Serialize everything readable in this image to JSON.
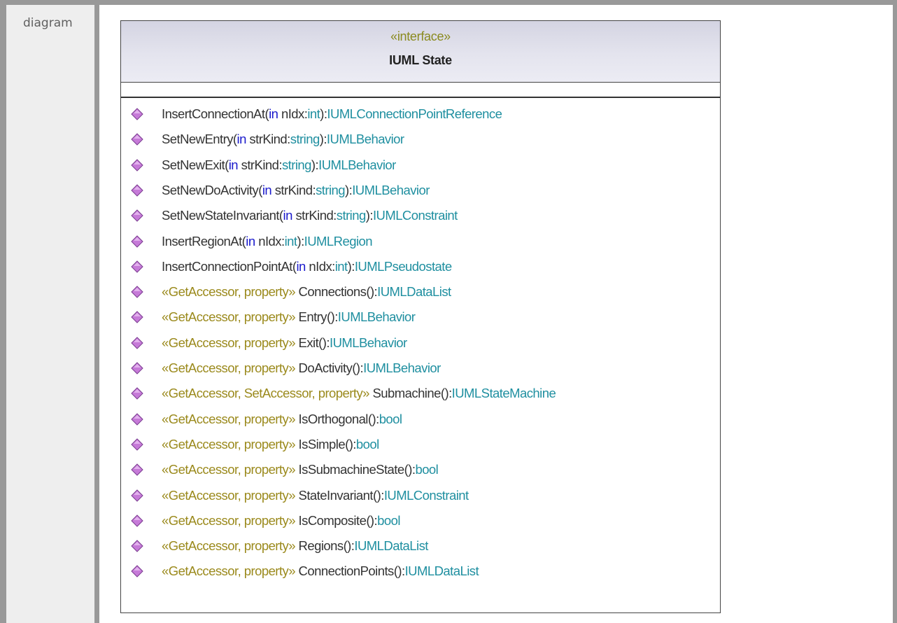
{
  "section_label": "diagram",
  "class_box": {
    "stereotype": "«interface»",
    "name": "IUML State"
  },
  "colors": {
    "header_gradient_top": "#d4d4e2",
    "stereotype": "#9b8a1d",
    "keyword": "#1a1acc",
    "type": "#1f8fa0",
    "icon_fill": "#c67ad8",
    "frame": "#999999"
  },
  "operation_icon": "operation-diamond-icon",
  "operations": [
    {
      "stereotype": "",
      "name": "InsertConnectionAt(",
      "kw": "in",
      "param": " nIdx:",
      "param_type": "int",
      "close": "):",
      "ret": "IUMLConnectionPointReference"
    },
    {
      "stereotype": "",
      "name": "SetNewEntry(",
      "kw": "in",
      "param": " strKind:",
      "param_type": "string",
      "close": "):",
      "ret": "IUMLBehavior"
    },
    {
      "stereotype": "",
      "name": "SetNewExit(",
      "kw": "in",
      "param": " strKind:",
      "param_type": "string",
      "close": "):",
      "ret": "IUMLBehavior"
    },
    {
      "stereotype": "",
      "name": "SetNewDoActivity(",
      "kw": "in",
      "param": " strKind:",
      "param_type": "string",
      "close": "):",
      "ret": "IUMLBehavior"
    },
    {
      "stereotype": "",
      "name": "SetNewStateInvariant(",
      "kw": "in",
      "param": " strKind:",
      "param_type": "string",
      "close": "):",
      "ret": "IUMLConstraint"
    },
    {
      "stereotype": "",
      "name": "InsertRegionAt(",
      "kw": "in",
      "param": " nIdx:",
      "param_type": "int",
      "close": "):",
      "ret": "IUMLRegion"
    },
    {
      "stereotype": "",
      "name": "InsertConnectionPointAt(",
      "kw": "in",
      "param": " nIdx:",
      "param_type": "int",
      "close": "):",
      "ret": "IUMLPseudostate"
    },
    {
      "stereotype": "«GetAccessor, property» ",
      "name": "Connections():",
      "kw": "",
      "param": "",
      "param_type": "",
      "close": "",
      "ret": "IUMLDataList"
    },
    {
      "stereotype": "«GetAccessor, property» ",
      "name": "Entry():",
      "kw": "",
      "param": "",
      "param_type": "",
      "close": "",
      "ret": "IUMLBehavior"
    },
    {
      "stereotype": "«GetAccessor, property» ",
      "name": "Exit():",
      "kw": "",
      "param": "",
      "param_type": "",
      "close": "",
      "ret": "IUMLBehavior"
    },
    {
      "stereotype": "«GetAccessor, property» ",
      "name": "DoActivity():",
      "kw": "",
      "param": "",
      "param_type": "",
      "close": "",
      "ret": "IUMLBehavior"
    },
    {
      "stereotype": "«GetAccessor, SetAccessor, property» ",
      "name": "Submachine():",
      "kw": "",
      "param": "",
      "param_type": "",
      "close": "",
      "ret": "IUMLStateMachine"
    },
    {
      "stereotype": "«GetAccessor, property» ",
      "name": "IsOrthogonal():",
      "kw": "",
      "param": "",
      "param_type": "",
      "close": "",
      "ret": "bool"
    },
    {
      "stereotype": "«GetAccessor, property» ",
      "name": "IsSimple():",
      "kw": "",
      "param": "",
      "param_type": "",
      "close": "",
      "ret": "bool"
    },
    {
      "stereotype": "«GetAccessor, property» ",
      "name": "IsSubmachineState():",
      "kw": "",
      "param": "",
      "param_type": "",
      "close": "",
      "ret": "bool"
    },
    {
      "stereotype": "«GetAccessor, property» ",
      "name": "StateInvariant():",
      "kw": "",
      "param": "",
      "param_type": "",
      "close": "",
      "ret": "IUMLConstraint"
    },
    {
      "stereotype": "«GetAccessor, property» ",
      "name": "IsComposite():",
      "kw": "",
      "param": "",
      "param_type": "",
      "close": "",
      "ret": "bool"
    },
    {
      "stereotype": "«GetAccessor, property» ",
      "name": "Regions():",
      "kw": "",
      "param": "",
      "param_type": "",
      "close": "",
      "ret": "IUMLDataList"
    },
    {
      "stereotype": "«GetAccessor, property» ",
      "name": "ConnectionPoints():",
      "kw": "",
      "param": "",
      "param_type": "",
      "close": "",
      "ret": "IUMLDataList"
    }
  ]
}
